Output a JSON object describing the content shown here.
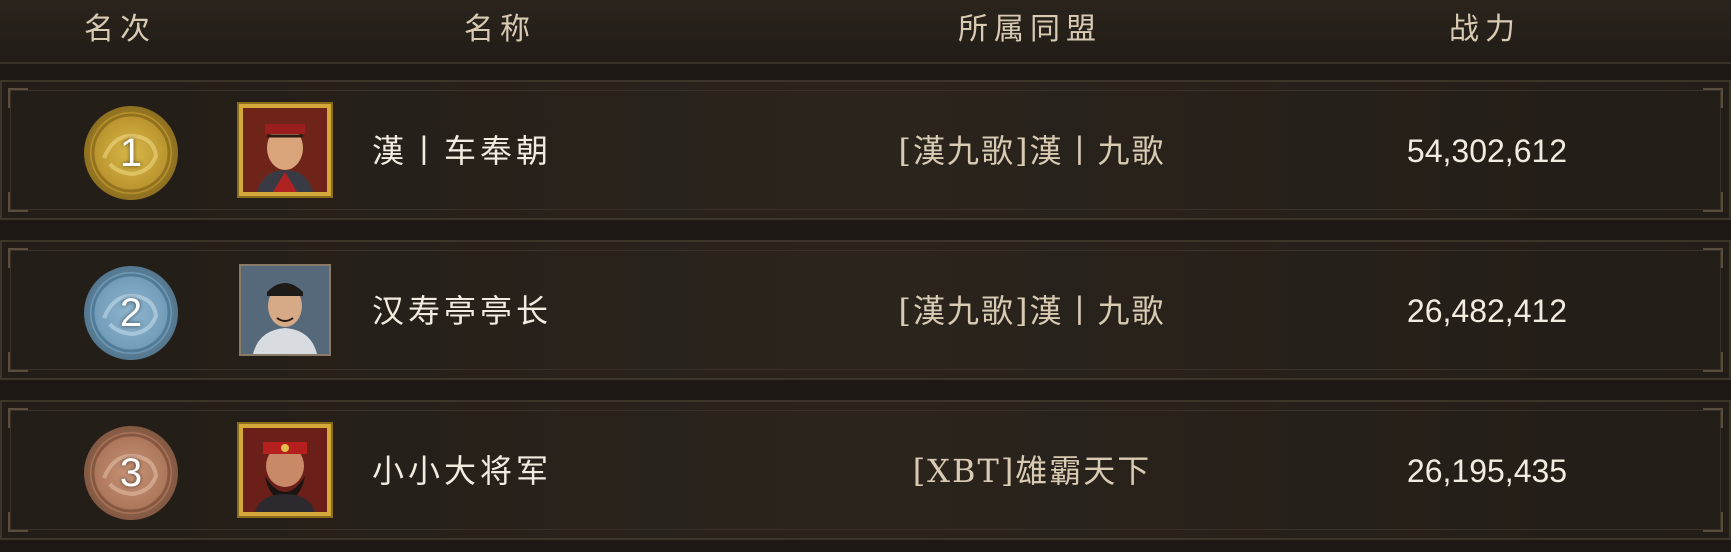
{
  "header": {
    "rank": "名次",
    "name": "名称",
    "alliance": "所属同盟",
    "power": "战力"
  },
  "rows": [
    {
      "rank": "1",
      "medal": "gold-dragon-medal",
      "avatar": "general-portrait-gold-frame",
      "name": "漢丨车奉朝",
      "alliance": "[漢九歌]漢丨九歌",
      "power": "54,302,612"
    },
    {
      "rank": "2",
      "medal": "silver-dragon-medal",
      "avatar": "scholar-portrait-plain-frame",
      "name": "汉寿亭亭长",
      "alliance": "[漢九歌]漢丨九歌",
      "power": "26,482,412"
    },
    {
      "rank": "3",
      "medal": "bronze-dragon-medal",
      "avatar": "warrior-portrait-gold-frame",
      "name": "小小大将军",
      "alliance": "[XBT]雄霸天下",
      "power": "26,195,435"
    }
  ],
  "colors": {
    "background": "#1d1813",
    "header_text": "#d9cbb3",
    "row_text": "#f2ece0",
    "gold": "#c9a23a",
    "silver": "#7fa8c4",
    "bronze": "#b98266"
  }
}
